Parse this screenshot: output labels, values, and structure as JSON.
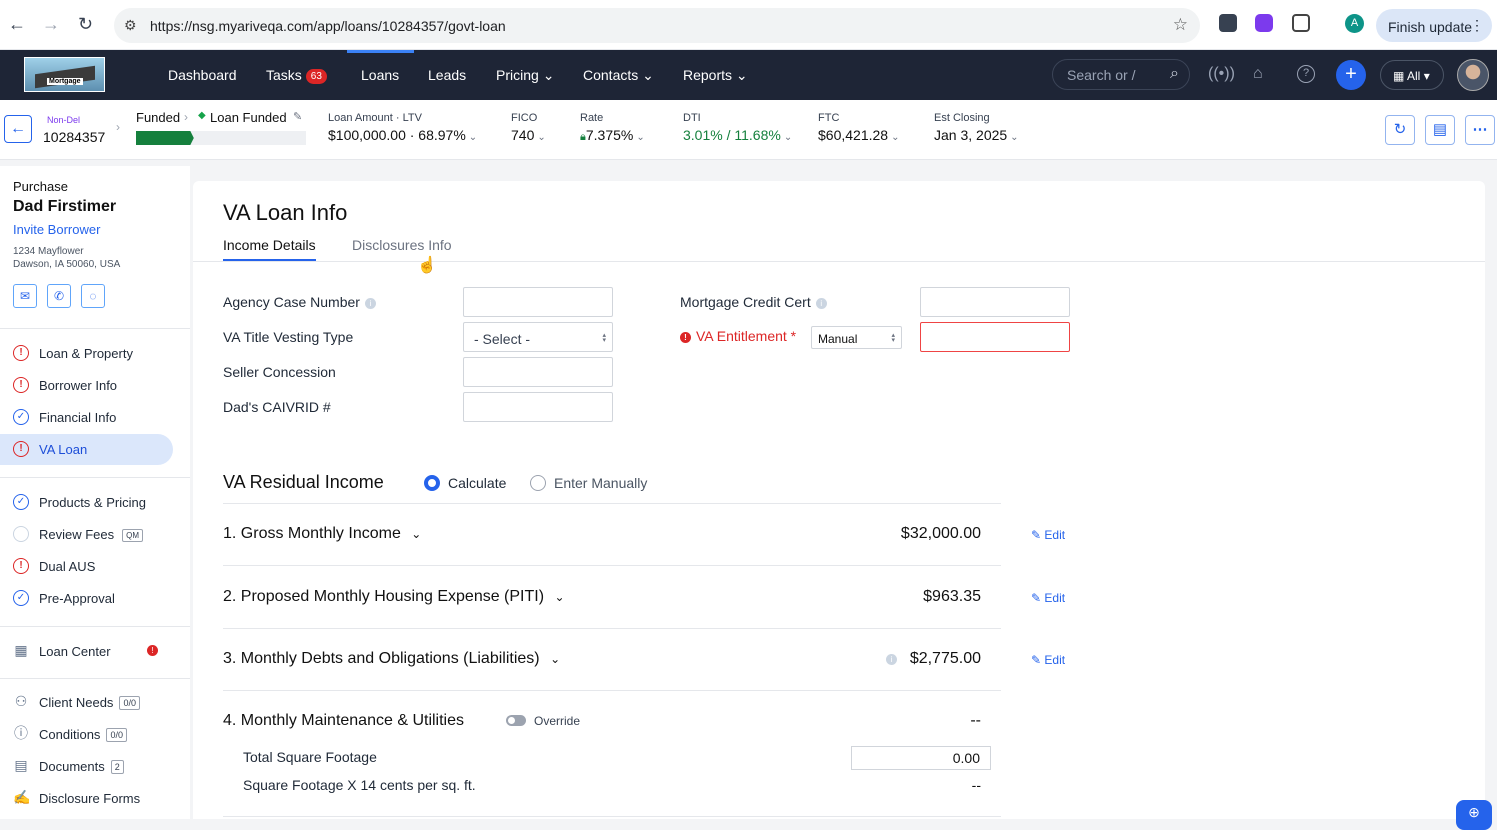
{
  "browser": {
    "url": "https://nsg.myariveqa.com/app/loans/10284357/govt-loan",
    "profile_initial": "A",
    "finish_update": "Finish update"
  },
  "nav": {
    "items": [
      "Dashboard",
      "Tasks",
      "Loans",
      "Leads",
      "Pricing",
      "Contacts",
      "Reports"
    ],
    "tasks_count": "63",
    "active": "Loans",
    "search_placeholder": "Search or /",
    "all_label": "All",
    "logo_text": "Mortgage"
  },
  "loan_header": {
    "tag": "Non-Del",
    "loan_number": "10284357",
    "stage": "Funded",
    "status": "Loan Funded",
    "progress_pct": 34,
    "metrics": [
      {
        "label": "Loan Amount · LTV",
        "value": "$100,000.00 · 68.97%"
      },
      {
        "label": "FICO",
        "value": "740"
      },
      {
        "label": "Rate",
        "value": "7.375%"
      },
      {
        "label": "DTI",
        "value": "3.01% / 11.68%"
      },
      {
        "label": "FTC",
        "value": "$60,421.28"
      },
      {
        "label": "Est Closing",
        "value": "Jan 3, 2025"
      }
    ]
  },
  "sidebar": {
    "loan_type": "Purchase",
    "borrower": "Dad Firstimer",
    "invite": "Invite Borrower",
    "address1": "1234 Mayflower",
    "address2": "Dawson, IA 50060, USA",
    "group1": [
      {
        "label": "Loan & Property",
        "status": "error"
      },
      {
        "label": "Borrower Info",
        "status": "error"
      },
      {
        "label": "Financial Info",
        "status": "ok"
      },
      {
        "label": "VA Loan",
        "status": "error",
        "selected": true
      }
    ],
    "group2": [
      {
        "label": "Products & Pricing",
        "status": "ok"
      },
      {
        "label": "Review Fees",
        "status": "empty",
        "tag": "QM"
      },
      {
        "label": "Dual AUS",
        "status": "error"
      },
      {
        "label": "Pre-Approval",
        "status": "ok"
      }
    ],
    "loan_center": "Loan Center",
    "group3": [
      {
        "label": "Client Needs",
        "count": "0/0"
      },
      {
        "label": "Conditions",
        "count": "0/0"
      },
      {
        "label": "Documents",
        "count": "2"
      },
      {
        "label": "Disclosure Forms",
        "count": ""
      }
    ]
  },
  "main": {
    "title": "VA Loan Info",
    "tabs": [
      "Income Details",
      "Disclosures Info"
    ],
    "fields_left": [
      {
        "label": "Agency Case Number",
        "value": ""
      },
      {
        "label": "VA Title Vesting Type",
        "value": "- Select -"
      },
      {
        "label": "Seller Concession",
        "value": ""
      },
      {
        "label": "Dad's CAIVRID #",
        "value": ""
      }
    ],
    "mortgage_credit_cert": "Mortgage Credit Cert",
    "va_entitlement": "VA Entitlement",
    "va_entitlement_mode": "Manual",
    "residual": {
      "title": "VA Residual Income",
      "radio_calc": "Calculate",
      "radio_manual": "Enter Manually",
      "rows": [
        {
          "title": "1.  Gross Monthly Income",
          "value": "$32,000.00"
        },
        {
          "title": "2.  Proposed Monthly Housing Expense (PITI)",
          "value": "$963.35"
        },
        {
          "title": "3.  Monthly Debts and Obligations (Liabilities)",
          "value": "$2,775.00"
        },
        {
          "title": "4.  Monthly Maintenance & Utilities",
          "value": "--"
        }
      ],
      "edit_label": "Edit",
      "override_label": "Override",
      "total_sqft_label": "Total Square Footage",
      "total_sqft_value": "0.00",
      "sqft_calc_label": "Square Footage X 14 cents per sq. ft.",
      "sqft_calc_value": "--"
    }
  }
}
